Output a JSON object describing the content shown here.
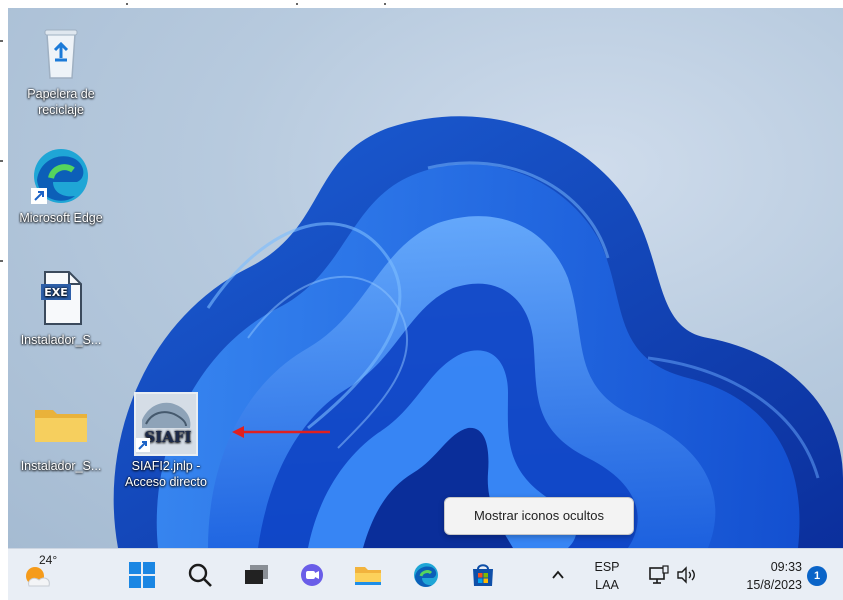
{
  "desktop_icons": [
    {
      "name": "recycle-bin",
      "label": "Papelera de reciclaje",
      "icon": "recycle-bin-icon"
    },
    {
      "name": "microsoft-edge",
      "label": "Microsoft Edge",
      "icon": "edge-icon"
    },
    {
      "name": "installer-exe",
      "label": "Instalador_S...",
      "icon": "exe-file-icon"
    },
    {
      "name": "installer-folder",
      "label": "Instalador_S...",
      "icon": "folder-icon"
    },
    {
      "name": "siafi-shortcut",
      "label": "SIAFI2.jnlp - Acceso directo",
      "icon": "siafi-logo-icon",
      "logo_text": "SIAFI"
    }
  ],
  "tooltip": {
    "text": "Mostrar iconos ocultos"
  },
  "taskbar": {
    "weather_temp": "24°",
    "icons": [
      "windows-start-icon",
      "search-icon",
      "task-view-icon",
      "chat-icon",
      "file-explorer-icon",
      "edge-icon",
      "store-icon"
    ],
    "show_hidden_icon": "chevron-up-icon",
    "language_top": "ESP",
    "language_bottom": "LAA",
    "network_icon": "network-icon",
    "volume_icon": "speaker-icon",
    "time": "09:33",
    "date": "15/8/2023",
    "notifications": "1"
  },
  "colors": {
    "accent": "#0a64c8",
    "arrow": "#e02020",
    "bloom": "#1e6fe6"
  }
}
